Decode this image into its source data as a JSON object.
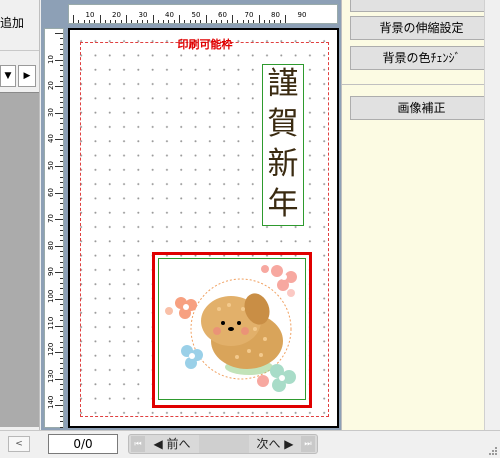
{
  "left_panel": {
    "label": "追加",
    "dropdown_arrow": "▼",
    "next_arrow": "▶"
  },
  "canvas": {
    "print_area_label": "印刷可能枠",
    "title_chars": [
      "謹",
      "賀",
      "新",
      "年"
    ],
    "ruler_top_labels": [
      "10",
      "20",
      "30",
      "40",
      "50",
      "60",
      "70",
      "80",
      "90"
    ],
    "ruler_left_labels": [
      "10",
      "20",
      "30",
      "40",
      "50",
      "60",
      "70",
      "80",
      "90",
      "100",
      "110",
      "120",
      "130",
      "140"
    ]
  },
  "right_panel": {
    "buttons": [
      "背景の伸縮設定",
      "背景の色ﾁｪﾝｼﾞ"
    ],
    "image_correction_button": "画像補正"
  },
  "bottom_bar": {
    "page_indicator": "0/0",
    "prev_label": "前へ",
    "next_label": "次へ",
    "first_icon": "⏮",
    "last_icon": "⏭"
  },
  "colors": {
    "accent_red": "#e00000",
    "frame_green": "#2e9a2e",
    "canvas_bg": "#8da0b6",
    "right_panel_bg": "#fcfbe3"
  }
}
